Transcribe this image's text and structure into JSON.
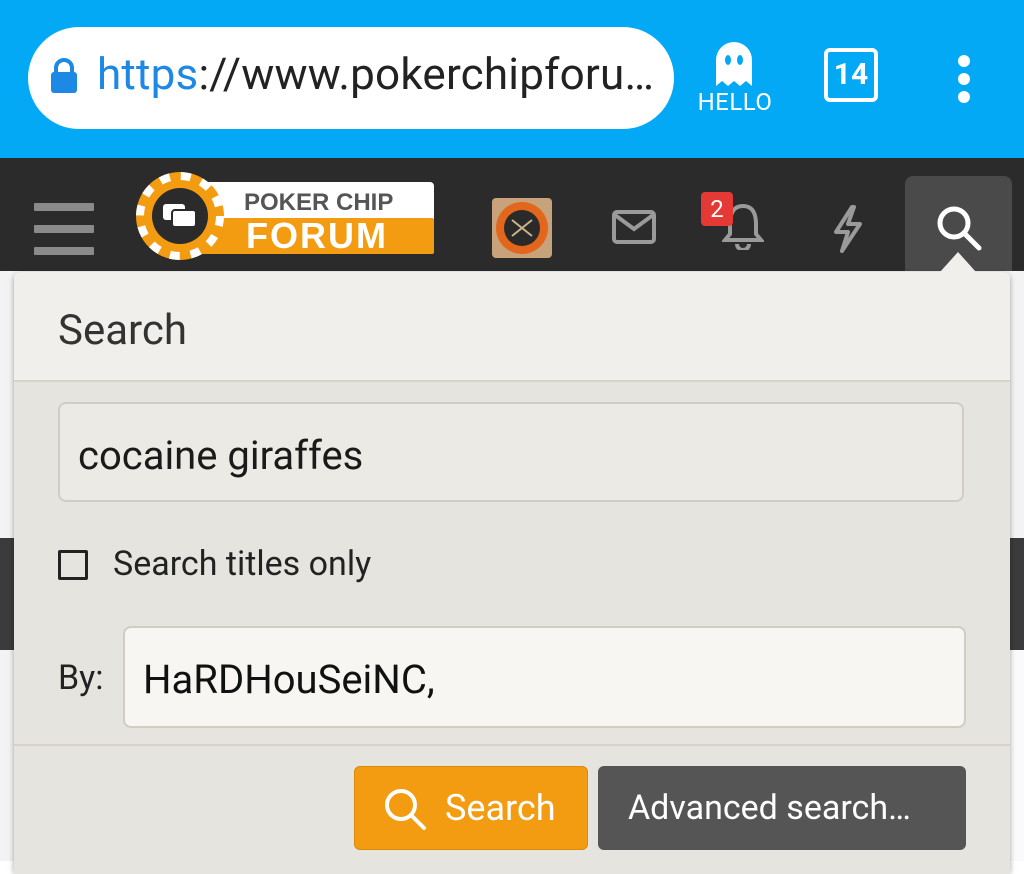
{
  "browser": {
    "url_scheme": "https",
    "url_rest": "://www.pokerchipforu…",
    "ghost_label": "HELLO",
    "tab_count": "14",
    "accent_color": "#03a9f4"
  },
  "header": {
    "logo_top": "POKER CHIP",
    "logo_bottom": "FORUM",
    "alerts_badge": "2",
    "icons": [
      "menu-icon",
      "envelope-icon",
      "bell-icon",
      "bolt-icon",
      "search-icon"
    ]
  },
  "search_panel": {
    "title": "Search",
    "query": "cocaine giraffes",
    "titles_only_label": "Search titles only",
    "titles_only_checked": false,
    "by_label": "By:",
    "by_value": "HaRDHouSeiNC,",
    "search_button": "Search",
    "advanced_button": "Advanced search…",
    "search_button_color": "#f39c12"
  }
}
